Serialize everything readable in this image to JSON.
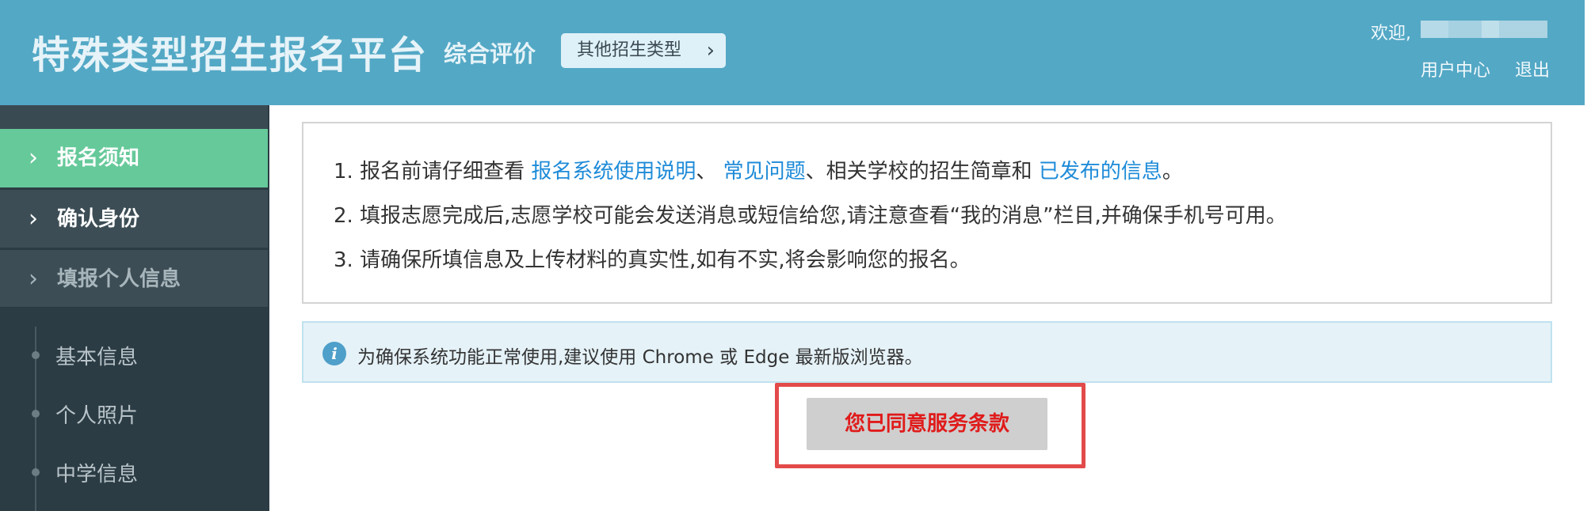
{
  "header": {
    "title": "特殊类型招生报名平台",
    "subtitle": "综合评价",
    "type_button": "其他招生类型",
    "welcome": "欢迎,",
    "user_center": "用户中心",
    "logout": "退出"
  },
  "sidebar": {
    "items": [
      {
        "label": "报名须知",
        "state": "active"
      },
      {
        "label": "确认身份",
        "state": "enabled"
      },
      {
        "label": "填报个人信息",
        "state": "disabled"
      }
    ],
    "sub_items": [
      "基本信息",
      "个人照片",
      "中学信息"
    ]
  },
  "notice": {
    "line1": {
      "prefix": "1. 报名前请仔细查看 ",
      "link1": "报名系统使用说明",
      "sep1": "、 ",
      "link2": "常见问题",
      "mid": "、相关学校的招生简章和 ",
      "link3": "已发布的信息",
      "end": "。"
    },
    "line2": "2. 填报志愿完成后,志愿学校可能会发送消息或短信给您,请注意查看“我的消息”栏目,并确保手机号可用。",
    "line3": "3. 请确保所填信息及上传材料的真实性,如有不实,将会影响您的报名。"
  },
  "tip": {
    "icon": "info-icon",
    "text": "为确保系统功能正常使用,建议使用 Chrome 或 Edge 最新版浏览器。"
  },
  "agree_button": "您已同意服务条款",
  "colors": {
    "header_bg": "#53a8c5",
    "sidebar_bg": "#2c3c44",
    "active_item": "#66c99a",
    "link": "#1e8bd8",
    "agree_text": "#e01b1b",
    "highlight_frame": "#e34a4a"
  }
}
